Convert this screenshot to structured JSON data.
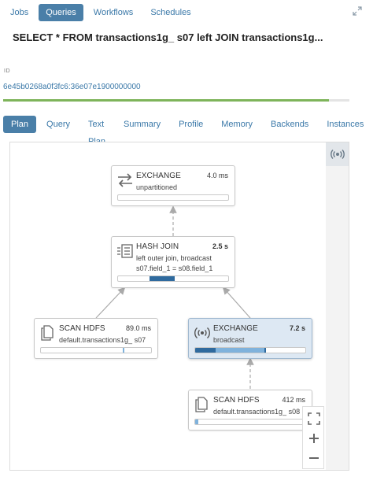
{
  "topnav": {
    "items": [
      {
        "label": "Jobs",
        "active": false
      },
      {
        "label": "Queries",
        "active": true
      },
      {
        "label": "Workflows",
        "active": false
      },
      {
        "label": "Schedules",
        "active": false
      }
    ]
  },
  "query": {
    "title": "SELECT * FROM transactions1g_ s07 left JOIN transactions1g...",
    "id_label": "ID",
    "id_value": "6e45b0268a0f3fc6:36e07e1900000000",
    "progress": 0.94
  },
  "tabs": [
    {
      "label": "Plan",
      "active": true
    },
    {
      "label": "Query",
      "active": false
    },
    {
      "label": "Text Plan",
      "active": false
    },
    {
      "label": "Summary",
      "active": false
    },
    {
      "label": "Profile",
      "active": false
    },
    {
      "label": "Memory",
      "active": false
    },
    {
      "label": "Backends",
      "active": false
    },
    {
      "label": "Instances",
      "active": false
    }
  ],
  "plan": {
    "nodes": {
      "exchange_top": {
        "name": "EXCHANGE",
        "time": "4.0 ms",
        "detail1": "unpartitioned",
        "icon": "exchange-arrows-icon"
      },
      "hash_join": {
        "name": "HASH JOIN",
        "time": "2.5 s",
        "detail1": "left outer join, broadcast",
        "detail2": "s07.field_1 = s08.field_1",
        "icon": "hash-join-icon"
      },
      "scan_left": {
        "name": "SCAN HDFS",
        "time": "89.0 ms",
        "detail1": "default.transactions1g_ s07",
        "icon": "scan-file-icon"
      },
      "exchange_bcast": {
        "name": "EXCHANGE",
        "time": "7.2 s",
        "detail1": "broadcast",
        "icon": "broadcast-icon"
      },
      "scan_right": {
        "name": "SCAN HDFS",
        "time": "412 ms",
        "detail1": "default.transactions1g_ s08",
        "icon": "scan-file-icon"
      }
    }
  },
  "colors": {
    "accent": "#4a7fa8",
    "progress": "#7eb45a",
    "bar_dark": "#2f6a9e",
    "bar_light": "#7fb2dc",
    "selected_bg": "#dde8f3"
  }
}
